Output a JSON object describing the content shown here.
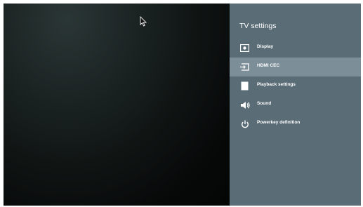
{
  "panel": {
    "title": "TV settings",
    "items": [
      {
        "label": "Display",
        "icon": "display-icon",
        "selected": false
      },
      {
        "label": "HDMI CEC",
        "icon": "hdmi-input-icon",
        "selected": true
      },
      {
        "label": "Playback settings",
        "icon": "playback-icon",
        "selected": false
      },
      {
        "label": "Sound",
        "icon": "speaker-icon",
        "selected": false
      },
      {
        "label": "Powerkey definition",
        "icon": "power-icon",
        "selected": false
      }
    ]
  },
  "colors": {
    "panel_bg": "#5a6d77",
    "selected_bg": "#7c8e97",
    "text": "#ffffff"
  }
}
